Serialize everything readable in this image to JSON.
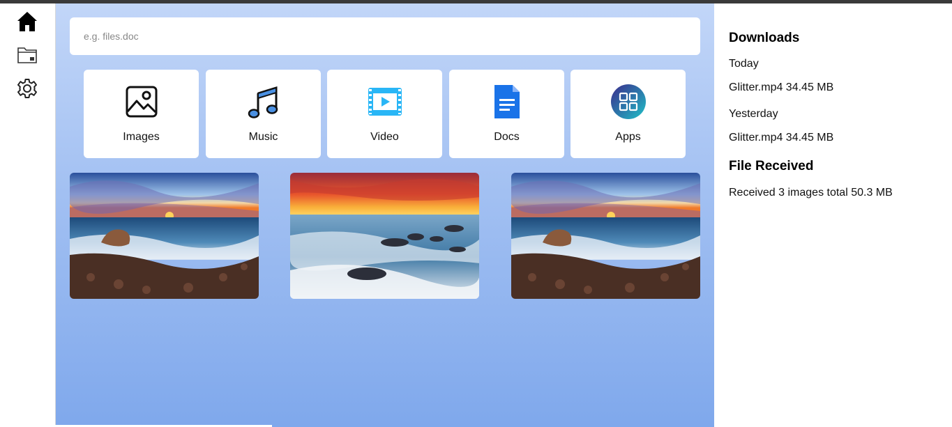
{
  "nav": {
    "items": [
      {
        "name": "home",
        "icon": "home-icon"
      },
      {
        "name": "files",
        "icon": "folder-icon"
      },
      {
        "name": "settings",
        "icon": "gear-icon"
      }
    ]
  },
  "search": {
    "placeholder": "e.g. files.doc",
    "value": ""
  },
  "categories": [
    {
      "label": "Images",
      "icon": "image-icon"
    },
    {
      "label": "Music",
      "icon": "music-icon"
    },
    {
      "label": "Video",
      "icon": "video-icon"
    },
    {
      "label": "Docs",
      "icon": "document-icon"
    },
    {
      "label": "Apps",
      "icon": "apps-icon"
    }
  ],
  "gallery": [
    {
      "subject": "rocky beach at sunset"
    },
    {
      "subject": "seascape with red sunset sky"
    },
    {
      "subject": "rocky beach at sunset"
    }
  ],
  "downloads": {
    "title": "Downloads",
    "groups": [
      {
        "label": "Today",
        "item": "Glitter.mp4 34.45 MB"
      },
      {
        "label": "Yesterday",
        "item": "Glitter.mp4 34.45 MB"
      }
    ]
  },
  "received": {
    "title": "File Received",
    "item": "Received 3 images total 50.3 MB"
  },
  "colors": {
    "accent_blue": "#1a73e8",
    "video_cyan": "#29b6f6",
    "background_top": "#c2d6f8",
    "background_bottom": "#7fa8ec"
  }
}
